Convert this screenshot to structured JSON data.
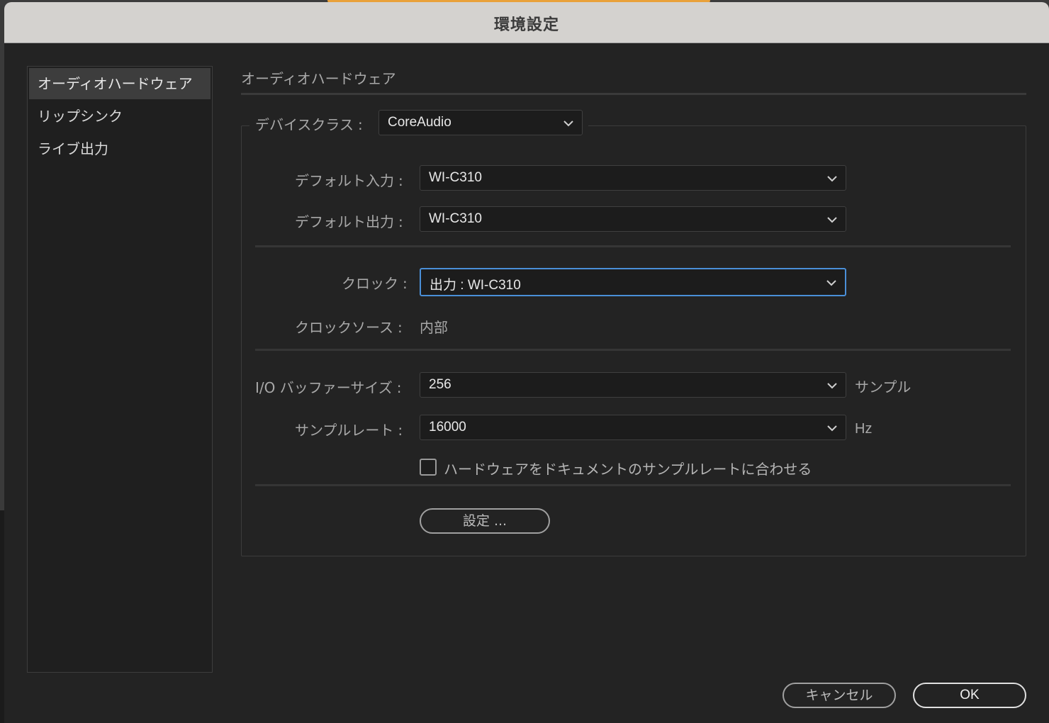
{
  "window": {
    "title": "環境設定"
  },
  "sidebar": {
    "items": [
      {
        "label": "オーディオハードウェア",
        "selected": true
      },
      {
        "label": "リップシンク",
        "selected": false
      },
      {
        "label": "ライブ出力",
        "selected": false
      }
    ]
  },
  "main": {
    "section_title": "オーディオハードウェア",
    "device_class": {
      "label": "デバイスクラス",
      "value": "CoreAudio"
    },
    "default_input": {
      "label": "デフォルト入力",
      "value": "WI-C310"
    },
    "default_output": {
      "label": "デフォルト出力",
      "value": "WI-C310"
    },
    "clock": {
      "label": "クロック",
      "value": "出力 : WI-C310"
    },
    "clock_source": {
      "label": "クロックソース",
      "value": "内部"
    },
    "io_buffer": {
      "label": "I/O バッファーサイズ",
      "value": "256",
      "unit": "サンプル"
    },
    "sample_rate": {
      "label": "サンプルレート",
      "value": "16000",
      "unit": "Hz"
    },
    "match_checkbox": {
      "label": "ハードウェアをドキュメントのサンプルレートに合わせる",
      "checked": false
    },
    "settings_button": "設定 ..."
  },
  "footer": {
    "cancel": "キャンセル",
    "ok": "OK"
  },
  "colors": {
    "focus": "#4a8fd8",
    "background": "#232323"
  }
}
